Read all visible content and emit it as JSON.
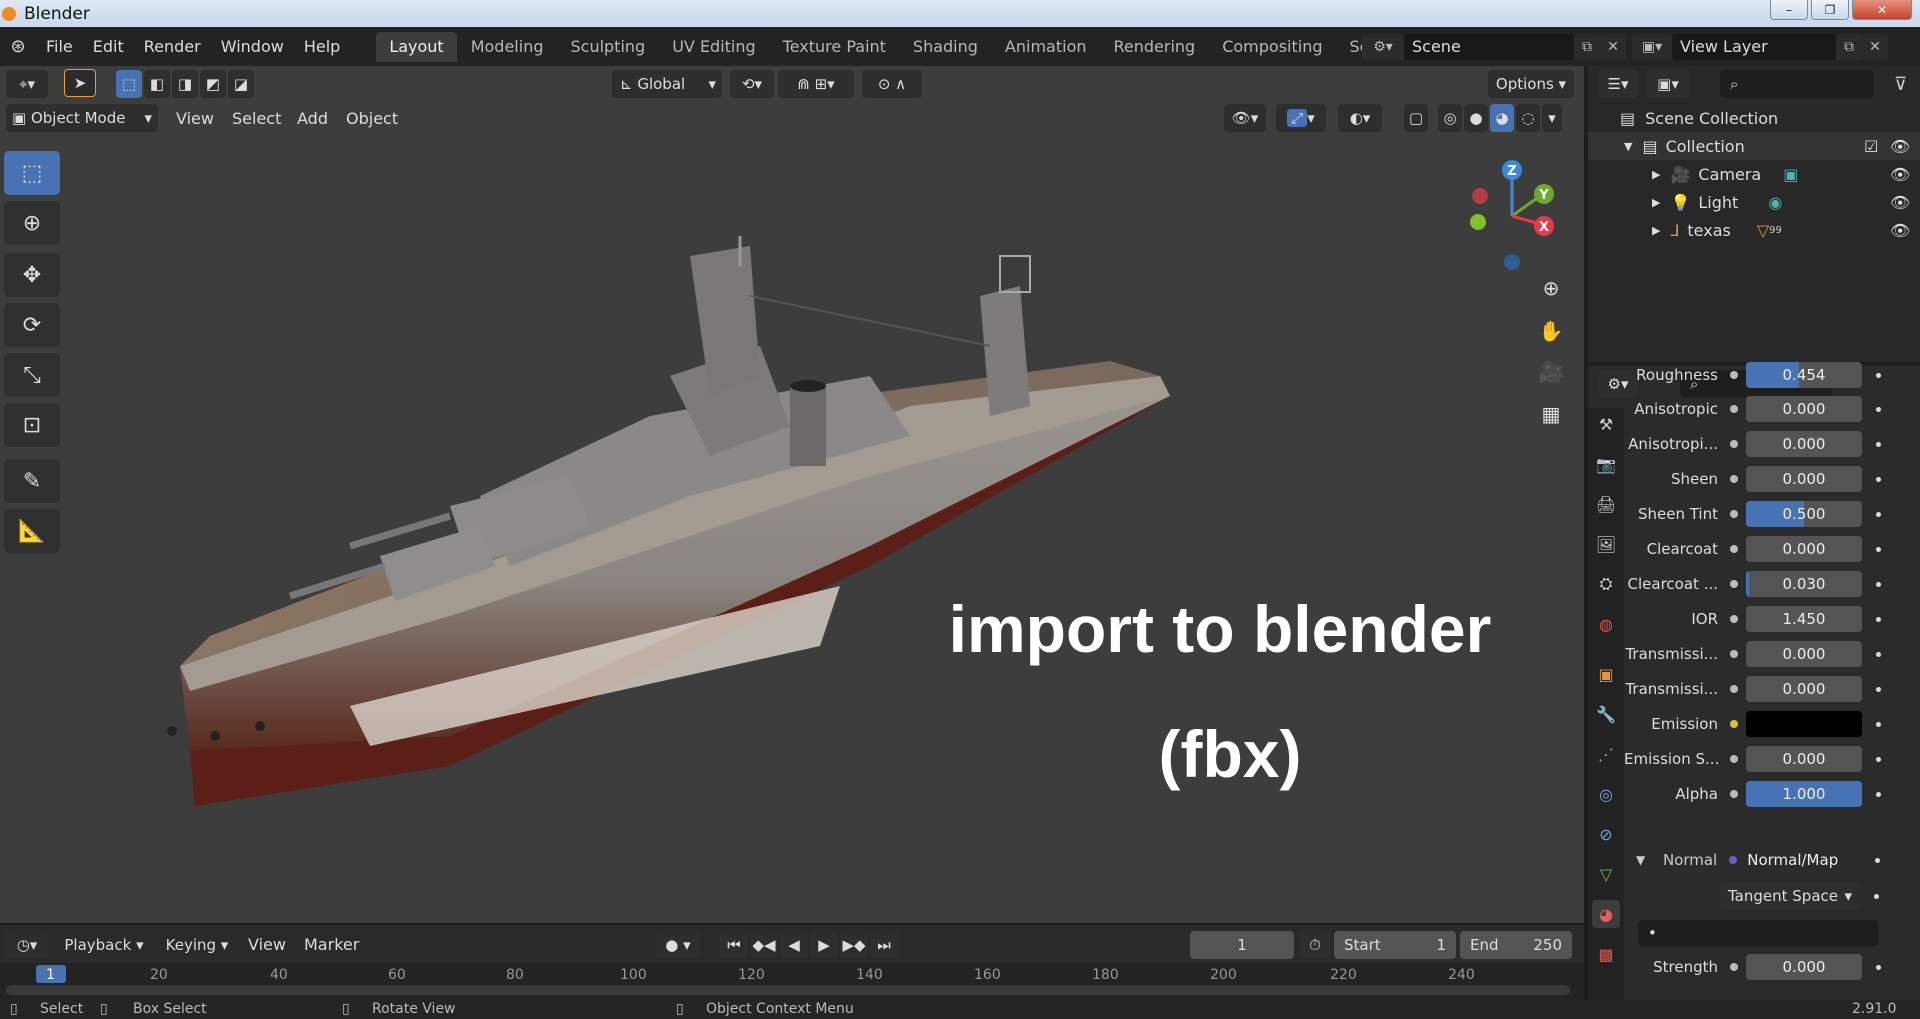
{
  "window": {
    "title": "Blender",
    "min": "–",
    "max": "❐",
    "close": "✕"
  },
  "menu": {
    "items": [
      "File",
      "Edit",
      "Render",
      "Window",
      "Help"
    ]
  },
  "workspaces": {
    "tabs": [
      "Layout",
      "Modeling",
      "Sculpting",
      "UV Editing",
      "Texture Paint",
      "Shading",
      "Animation",
      "Rendering",
      "Compositing",
      "Scripting"
    ],
    "active": "Layout",
    "add": "+"
  },
  "scene": {
    "name": "Scene",
    "view_layer": "View Layer"
  },
  "viewport": {
    "transform_orientation": "Global",
    "options_label": "Options",
    "mode": "Object Mode",
    "menus": [
      "View",
      "Select",
      "Add",
      "Object"
    ],
    "overlay_title": "import to blender",
    "overlay_sub": "(fbx)",
    "axes": {
      "z": "Z",
      "y": "Y",
      "x": "X"
    }
  },
  "timeline": {
    "menus": [
      "Playback",
      "Keying",
      "View",
      "Marker"
    ],
    "current_frame": "1",
    "start_label": "Start",
    "start_value": "1",
    "end_label": "End",
    "end_value": "250",
    "ticks": [
      "1",
      "20",
      "40",
      "60",
      "80",
      "100",
      "120",
      "140",
      "160",
      "180",
      "200",
      "220",
      "240"
    ]
  },
  "outliner": {
    "root": "Scene Collection",
    "collection": "Collection",
    "items": [
      {
        "name": "Camera"
      },
      {
        "name": "Light"
      },
      {
        "name": "texas",
        "badge": "99"
      }
    ]
  },
  "properties": {
    "rows": [
      {
        "label": "Roughness",
        "value": "0.454",
        "fill": 0.454
      },
      {
        "label": "Anisotropic",
        "value": "0.000",
        "fill": 0
      },
      {
        "label": "Anisotropi...",
        "value": "0.000",
        "fill": 0
      },
      {
        "label": "Sheen",
        "value": "0.000",
        "fill": 0
      },
      {
        "label": "Sheen Tint",
        "value": "0.500",
        "fill": 0.5
      },
      {
        "label": "Clearcoat",
        "value": "0.000",
        "fill": 0
      },
      {
        "label": "Clearcoat ...",
        "value": "0.030",
        "fill": 0.03
      },
      {
        "label": "IOR",
        "value": "1.450",
        "fill": 0
      },
      {
        "label": "Transmissi...",
        "value": "0.000",
        "fill": 0
      },
      {
        "label": "Transmissi...",
        "value": "0.000",
        "fill": 0
      },
      {
        "label": "Emission",
        "value": "",
        "fill": 0,
        "color": "#000000"
      },
      {
        "label": "Emission S...",
        "value": "0.000",
        "fill": 0
      },
      {
        "label": "Alpha",
        "value": "1.000",
        "fill": 1
      }
    ],
    "normal_label": "Normal",
    "normal_value": "Normal/Map",
    "tangent": "Tangent Space",
    "strength_label": "Strength",
    "strength_value": "0.000"
  },
  "status": {
    "select": "Select",
    "box_select": "Box Select",
    "rotate_view": "Rotate View",
    "context_menu": "Object Context Menu",
    "version": "2.91.0"
  },
  "colors": {
    "accent": "#4772b3",
    "x_axis": "#e8394a",
    "y_axis": "#6da92c",
    "z_axis": "#3a8be0"
  }
}
